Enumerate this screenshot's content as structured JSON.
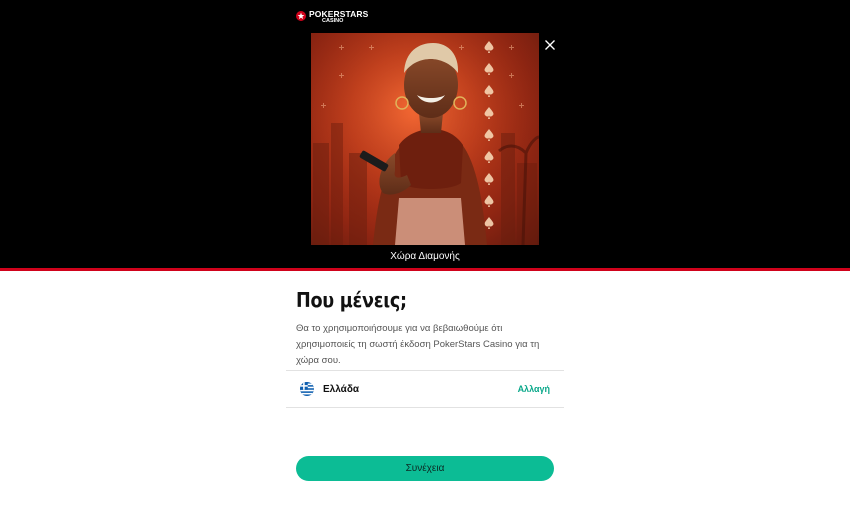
{
  "brand": {
    "name": "POKERSTARS",
    "sub": "CASINO",
    "accent": "#d0021b"
  },
  "hero": {
    "caption": "Χώρα Διαμονής"
  },
  "dialog": {
    "title": "Που μένεις;",
    "description": "Θα το χρησιμοποιήσουμε για να βεβαιωθούμε ότι χρησιμοποιείς τη σωστή έκδοση PokerStars Casino για τη χώρα σου."
  },
  "country": {
    "flag_icon": "greece-flag-icon",
    "name": "Ελλάδα",
    "change_label": "Αλλαγή",
    "link_color": "#0aa88a"
  },
  "actions": {
    "continue_label": "Συνέχεια",
    "button_color": "#0cbc95"
  },
  "icons": {
    "close": "close-icon",
    "logo": "pokerstars-logo-icon"
  }
}
